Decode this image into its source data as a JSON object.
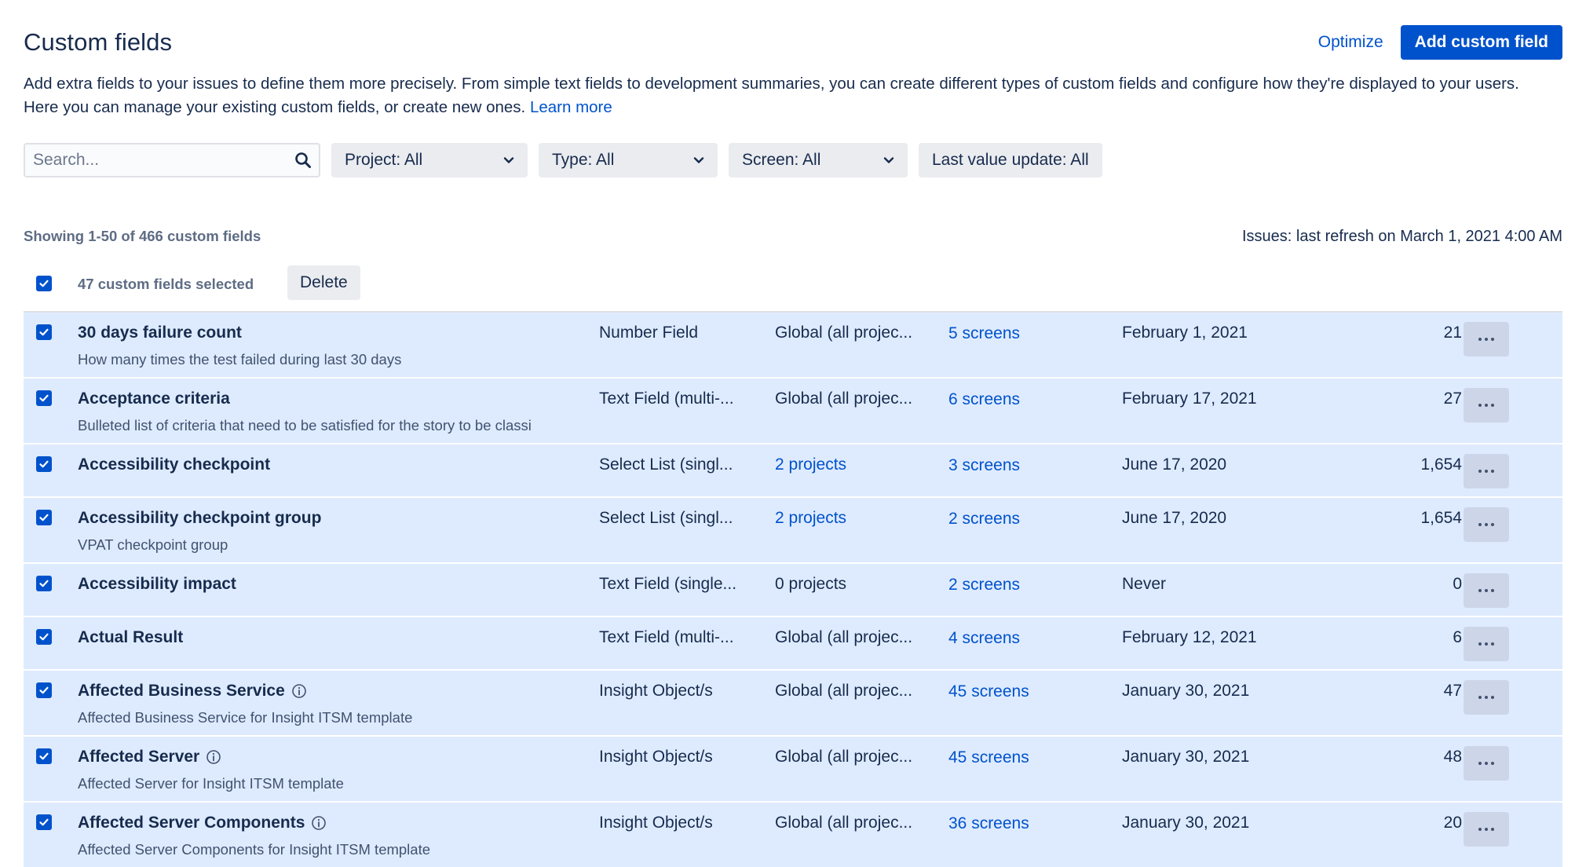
{
  "header": {
    "title": "Custom fields",
    "optimize_label": "Optimize",
    "add_label": "Add custom field"
  },
  "description": {
    "text": "Add extra fields to your issues to define them more precisely. From simple text fields to development summaries, you can create different types of custom fields and configure how they're displayed to your users. Here you can manage your existing custom fields, or create new ones.",
    "learn_more": "Learn more"
  },
  "filters": {
    "search_placeholder": "Search...",
    "project": "Project: All",
    "type": "Type: All",
    "screen": "Screen: All",
    "last_value_update": "Last value update: All"
  },
  "meta": {
    "showing": "Showing 1-50 of 466 custom fields",
    "refresh": "Issues: last refresh on March 1, 2021 4:00 AM"
  },
  "bulk": {
    "selected_label": "47 custom fields selected",
    "delete_label": "Delete"
  },
  "colors": {
    "accent": "#0052cc",
    "row_selected": "#deebff",
    "neutral_button": "#ebecf0"
  },
  "rows": [
    {
      "name": "30 days failure count",
      "description": "How many times the test failed during last 30 days",
      "info": false,
      "type": "Number Field",
      "context": "Global (all projec...",
      "context_link": false,
      "screens": "5 screens",
      "last_update": "February 1, 2021",
      "issues": "21"
    },
    {
      "name": "Acceptance criteria",
      "description": "Bulleted list of criteria that need to be satisfied for the story to be classi",
      "info": false,
      "type": "Text Field (multi-...",
      "context": "Global (all projec...",
      "context_link": false,
      "screens": "6 screens",
      "last_update": "February 17, 2021",
      "issues": "27"
    },
    {
      "name": "Accessibility checkpoint",
      "description": "",
      "info": false,
      "type": "Select List (singl...",
      "context": "2 projects",
      "context_link": true,
      "screens": "3 screens",
      "last_update": "June 17, 2020",
      "issues": "1,654"
    },
    {
      "name": "Accessibility checkpoint group",
      "description": "VPAT checkpoint group",
      "info": false,
      "type": "Select List (singl...",
      "context": "2 projects",
      "context_link": true,
      "screens": "2 screens",
      "last_update": "June 17, 2020",
      "issues": "1,654"
    },
    {
      "name": "Accessibility impact",
      "description": "",
      "info": false,
      "type": "Text Field (single...",
      "context": "0 projects",
      "context_link": false,
      "screens": "2 screens",
      "last_update": "Never",
      "issues": "0"
    },
    {
      "name": "Actual Result",
      "description": "",
      "info": false,
      "type": "Text Field (multi-...",
      "context": "Global (all projec...",
      "context_link": false,
      "screens": "4 screens",
      "last_update": "February 12, 2021",
      "issues": "6"
    },
    {
      "name": "Affected Business Service",
      "description": "Affected Business Service for Insight ITSM template",
      "info": true,
      "type": "Insight Object/s",
      "context": "Global (all projec...",
      "context_link": false,
      "screens": "45 screens",
      "last_update": "January 30, 2021",
      "issues": "47"
    },
    {
      "name": "Affected Server",
      "description": "Affected Server for Insight ITSM template",
      "info": true,
      "type": "Insight Object/s",
      "context": "Global (all projec...",
      "context_link": false,
      "screens": "45 screens",
      "last_update": "January 30, 2021",
      "issues": "48"
    },
    {
      "name": "Affected Server Components",
      "description": "Affected Server Components for Insight ITSM template",
      "info": true,
      "type": "Insight Object/s",
      "context": "Global (all projec...",
      "context_link": false,
      "screens": "36 screens",
      "last_update": "January 30, 2021",
      "issues": "20"
    }
  ]
}
